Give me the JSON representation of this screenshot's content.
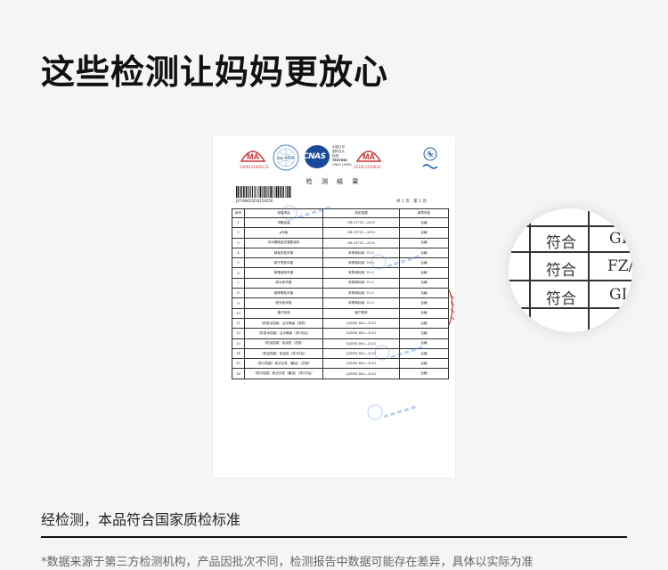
{
  "headline": "这些检测让妈妈更放心",
  "report": {
    "logos": {
      "ma_left": "MA",
      "ma_left_number": "2400111400111",
      "ilac": "ilac-MRA",
      "cnas": "CNAS",
      "cnas_side": [
        "中国认可",
        "国际互认",
        "检测",
        "TESTING",
        "CNAS L0450"
      ],
      "ma_right": "MA",
      "ma_right_number": "221011110632"
    },
    "title": "检 测 结 果",
    "barcode_number": "JST-BW2025015925E",
    "page_label": "共 2 页　第 2 页",
    "table": {
      "headers": [
        "序号",
        "检验项目",
        "判定依据",
        "单项判定"
      ],
      "rows": [
        [
          "1",
          "甲醛含量",
          "GB 31701—2015",
          "合格"
        ],
        [
          "2",
          "pH值",
          "GB 31701—2015",
          "合格"
        ],
        [
          "3",
          "可分解致癌芳香胺染料",
          "GB 31701—2015",
          "合格"
        ],
        [
          "4",
          "耐皂洗色牢度",
          "采购商标准: V2.0",
          "合格"
        ],
        [
          "5",
          "耐汗渍色牢度",
          "采购商标准: V2.0",
          "合格"
        ],
        [
          "6",
          "耐唾液色牢度",
          "采购商标准: V2.0",
          "合格"
        ],
        [
          "7",
          "耐水色牢度",
          "采购商标准: V2.0",
          "合格"
        ],
        [
          "8",
          "耐摩擦色牢度",
          "采购商标准: V2.0",
          "合格"
        ],
        [
          "9",
          "耐光色牢度",
          "采购商标准: V2.0",
          "合格"
        ],
        [
          "10",
          "绳子检测",
          "客户要求",
          "合格"
        ],
        [
          "11",
          "（防泼水性能）沾水等级（洗前）",
          "Q/ZSW 400—2021",
          "合格"
        ],
        [
          "12",
          "（防泼水性能）沾水等级（洗5次后）",
          "Q/ZSW 400—2021",
          "合格"
        ],
        [
          "13",
          "（防油性能）拒油性（洗前）",
          "Q/ZSW 400—2021",
          "合格"
        ],
        [
          "14",
          "（防油性能）拒油性（洗5次后）",
          "Q/ZSW 400—2021",
          "合格"
        ],
        [
          "15",
          "（防污性能）耐沾污性（酱油）（洗前）",
          "Q/ZSW 400—2021",
          "合格"
        ],
        [
          "16",
          "（防污性能）耐沾污性（酱油）（洗5次后）",
          "Q/ZSW 400—2021",
          "合格"
        ]
      ]
    }
  },
  "zoom": {
    "cells": [
      "符合",
      "符合",
      "符合"
    ],
    "right_cells": [
      "GI",
      "FZ/",
      "GI"
    ]
  },
  "caption": "经检测，本品符合国家质检标准",
  "footnote": "*数据来源于第三方检测机构，产品因批次不同，检测报告中数据可能存在差异，具体以实际为准",
  "colors": {
    "ma_red": "#cc3333",
    "cnas_blue": "#1a4a9a",
    "stamp_blue": "#3a7bd5",
    "seal_red": "#c0392b"
  }
}
